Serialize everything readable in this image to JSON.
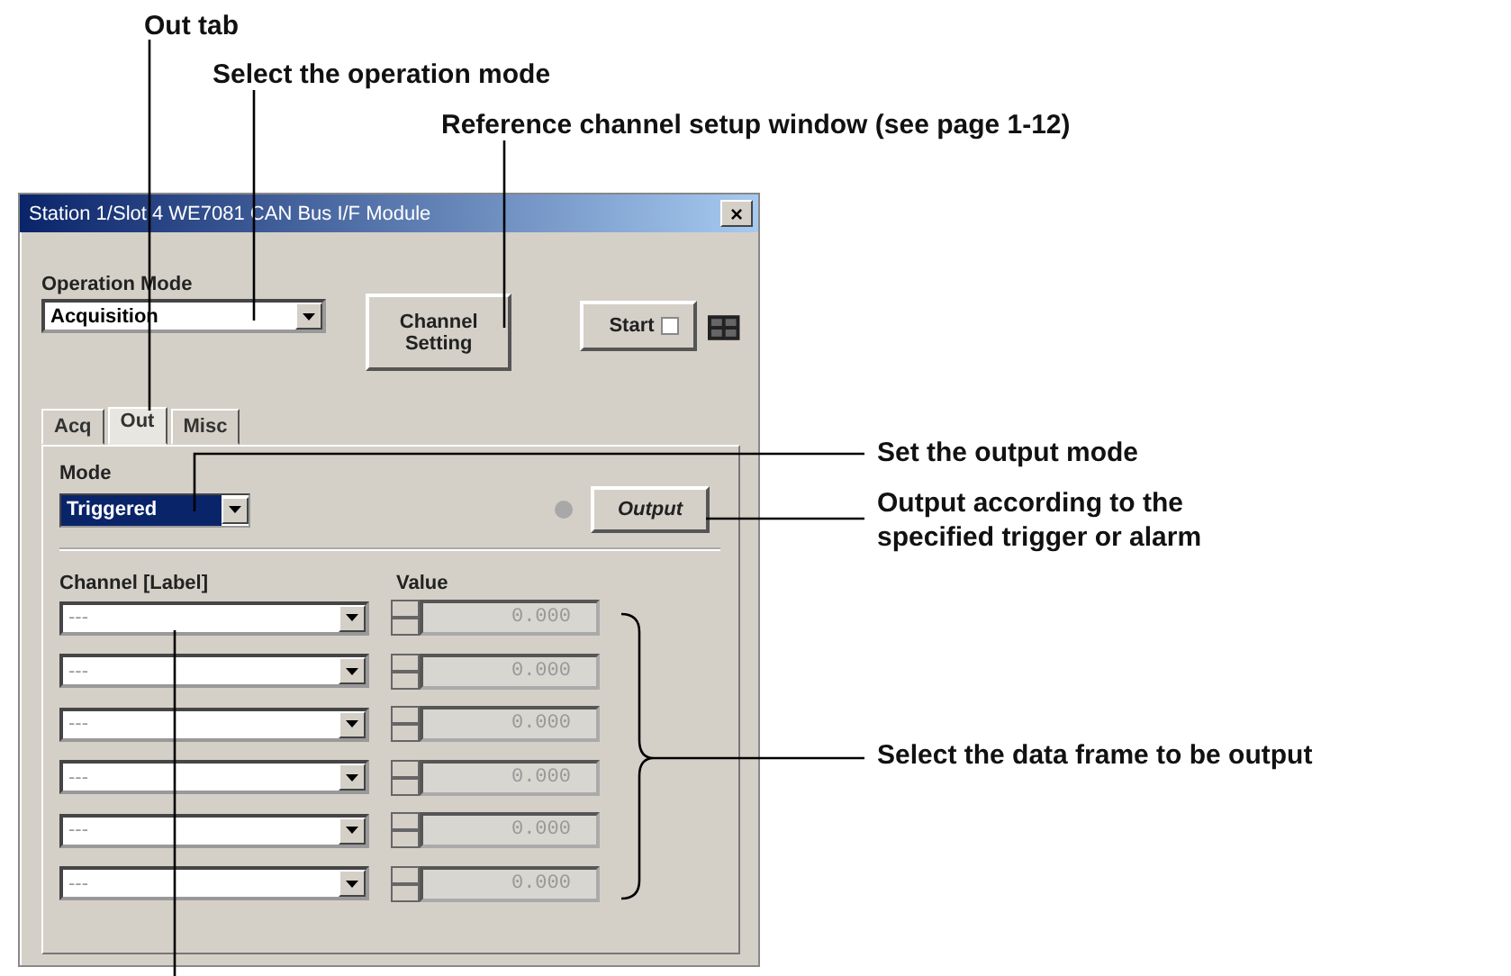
{
  "annotations": [
    {
      "text": "Out tab"
    },
    {
      "text": "Select the operation mode"
    },
    {
      "text": "Reference channel setup window (see page 1-12)"
    },
    {
      "text": "Set the output mode"
    },
    {
      "text": "Output according to the specified trigger or alarm"
    },
    {
      "text": "Select the data frame to be output"
    }
  ],
  "window": {
    "title": "Station 1/Slot 4 WE7081 CAN Bus I/F Module",
    "close": "×"
  },
  "operation_mode": {
    "label": "Operation Mode",
    "value": "Acquisition"
  },
  "channel_setting_button": "Channel Setting",
  "start": {
    "label": "Start",
    "checked": false
  },
  "tabs": [
    {
      "label": "Acq",
      "selected": false
    },
    {
      "label": "Out",
      "selected": true
    },
    {
      "label": "Misc",
      "selected": false
    }
  ],
  "mode": {
    "label": "Mode",
    "value": "Triggered",
    "highlighted": true
  },
  "output_lamp": {
    "lit": false
  },
  "output_button": "Output",
  "columns": [
    "Channel [Label]",
    "Value"
  ],
  "rows": [
    {
      "channel": "---",
      "value": "0.000",
      "disabled": true
    },
    {
      "channel": "---",
      "value": "0.000",
      "disabled": true
    },
    {
      "channel": "---",
      "value": "0.000",
      "disabled": true
    },
    {
      "channel": "---",
      "value": "0.000",
      "disabled": true
    },
    {
      "channel": "---",
      "value": "0.000",
      "disabled": true
    },
    {
      "channel": "---",
      "value": "0.000",
      "disabled": true
    }
  ]
}
